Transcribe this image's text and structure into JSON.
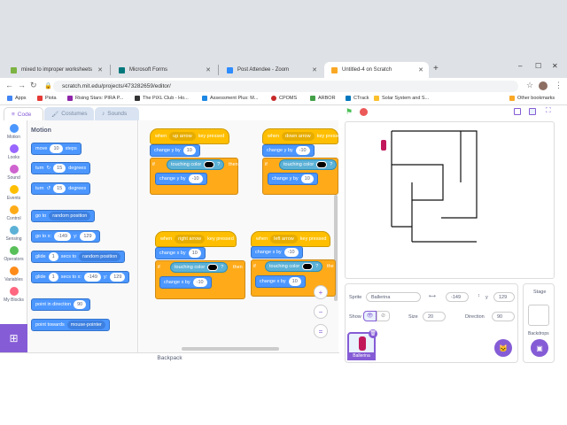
{
  "browser": {
    "tabs": [
      {
        "label": "mixed to improper worksheets",
        "color": "#7cb342"
      },
      {
        "label": "Microsoft Forms",
        "color": "#03787c"
      },
      {
        "label": "Post Attendee - Zoom",
        "color": "#2d8cff"
      },
      {
        "label": "Untitled-4 on Scratch",
        "color": "#f9a825"
      }
    ],
    "new_tab": "+",
    "url": "scratch.mit.edu/projects/473282659/editor/",
    "bookmarks": [
      "Apps",
      "Piota",
      "Rising Stars: PIRA P...",
      "The PiXL Club - Ho...",
      "Assessment Plus: M...",
      "CPOMS",
      "ARBOR",
      "CTrack",
      "Solar System and S...",
      "Other bookmarks"
    ]
  },
  "editor": {
    "tabs": {
      "code": "Code",
      "costumes": "Costumes",
      "sounds": "Sounds"
    },
    "categories": [
      {
        "label": "Motion",
        "color": "#4c97ff"
      },
      {
        "label": "Looks",
        "color": "#9966ff"
      },
      {
        "label": "Sound",
        "color": "#cf63cf"
      },
      {
        "label": "Events",
        "color": "#ffbf00"
      },
      {
        "label": "Control",
        "color": "#ffab19"
      },
      {
        "label": "Sensing",
        "color": "#5cb1d6"
      },
      {
        "label": "Operators",
        "color": "#59c059"
      },
      {
        "label": "Variables",
        "color": "#ff8c1a"
      },
      {
        "label": "My Blocks",
        "color": "#ff6680"
      }
    ],
    "palette_title": "Motion",
    "palette": {
      "move": {
        "a": "move",
        "v": "10",
        "b": "steps"
      },
      "turn_right": {
        "a": "turn",
        "v": "15",
        "b": "degrees"
      },
      "turn_left": {
        "a": "turn",
        "v": "15",
        "b": "degrees"
      },
      "go_to": {
        "a": "go to",
        "dd": "random position"
      },
      "go_to_xy": {
        "a": "go to x:",
        "x": "-149",
        "yl": "y:",
        "y": "129"
      },
      "glide_to": {
        "a": "glide",
        "v": "1",
        "b": "secs to",
        "dd": "random position"
      },
      "glide_xy": {
        "a": "glide",
        "v": "1",
        "b": "secs to x:",
        "x": "-149",
        "yl": "y:",
        "y": "129"
      },
      "point_dir": {
        "a": "point in direction",
        "v": "90"
      },
      "point_towards": {
        "a": "point towards",
        "dd": "mouse-pointer"
      }
    },
    "scripts": [
      {
        "when": "when",
        "key": "up arrow",
        "pressed": "key pressed",
        "change1": "change y by",
        "v1": "10",
        "if": "if",
        "touching": "touching color",
        "q": "?",
        "then": "then",
        "change2": "change y by",
        "v2": "-10"
      },
      {
        "when": "when",
        "key": "down arrow",
        "pressed": "key pressed",
        "change1": "change y by",
        "v1": "-10",
        "if": "if",
        "touching": "touching color",
        "q": "?",
        "then": "then",
        "change2": "change y by",
        "v2": "10"
      },
      {
        "when": "when",
        "key": "right arrow",
        "pressed": "key pressed",
        "change1": "change x by",
        "v1": "10",
        "if": "if",
        "touching": "touching color",
        "q": "?",
        "then": "then",
        "change2": "change x by",
        "v2": "-10"
      },
      {
        "when": "when",
        "key": "left arrow",
        "pressed": "key pressed",
        "change1": "change x by",
        "v1": "-10",
        "if": "if",
        "touching": "touching color",
        "q": "?",
        "then": "the",
        "change2": "change x by",
        "v2": "10"
      }
    ],
    "zoom": {
      "in": "+",
      "out": "−",
      "reset": "="
    },
    "backpack": "Backpack"
  },
  "sprite_info": {
    "sprite_label": "Sprite",
    "sprite_name": "Ballerina",
    "x": "-149",
    "y": "129",
    "show_label": "Show",
    "size_label": "Size",
    "size": "20",
    "direction_label": "Direction",
    "direction": "90",
    "thumb_name": "Ballerina"
  },
  "stage_panel": {
    "label": "Stage",
    "backdrops_label": "Backdrops"
  }
}
